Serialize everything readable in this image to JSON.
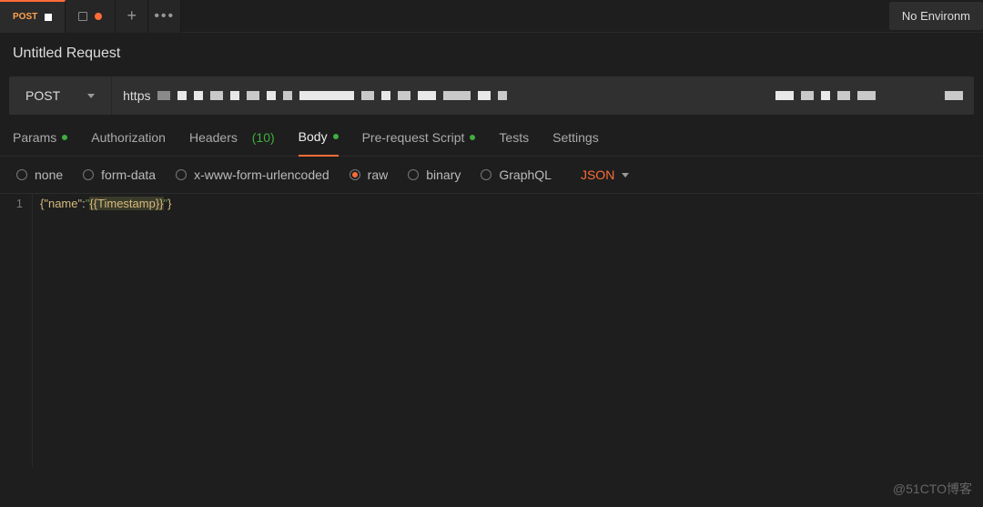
{
  "tabs": {
    "tab1_method": "POST",
    "tab2_has_unsaved": true
  },
  "environment_label": "No Environm",
  "request_title": "Untitled Request",
  "method": {
    "selected": "POST"
  },
  "url_prefix": "https",
  "req_tabs": {
    "params": "Params",
    "authorization": "Authorization",
    "headers": "Headers",
    "headers_count": "(10)",
    "body": "Body",
    "prerequest": "Pre-request Script",
    "tests": "Tests",
    "settings": "Settings"
  },
  "body_types": {
    "none": "none",
    "form_data": "form-data",
    "xwww": "x-www-form-urlencoded",
    "raw": "raw",
    "binary": "binary",
    "graphql": "GraphQL"
  },
  "raw_lang": "JSON",
  "editor": {
    "line_number": "1",
    "brace_open": "{",
    "key_quoted": "\"name\"",
    "colon": ":",
    "str_open": "\"",
    "variable": "{{Timestamp}}",
    "str_close": "\"",
    "brace_close": "}"
  },
  "watermark": "@51CTO博客"
}
